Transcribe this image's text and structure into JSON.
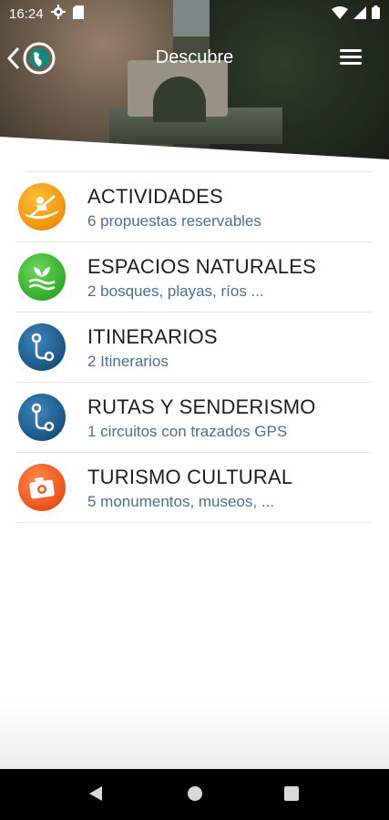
{
  "status_bar": {
    "time": "16:24"
  },
  "app_bar": {
    "title": "Descubre"
  },
  "colors": {
    "orange": "#f29a12",
    "green": "#39b233",
    "blue": "#1f5c8c",
    "red": "#f05a22",
    "subtitle": "#4a6f93"
  },
  "items": [
    {
      "title": "ACTIVIDADES",
      "subtitle": "6 propuestas reservables",
      "icon": "kayak-icon"
    },
    {
      "title": "ESPACIOS NATURALES",
      "subtitle": "2 bosques, playas, ríos ...",
      "icon": "nature-icon"
    },
    {
      "title": "ITINERARIOS",
      "subtitle": "2 Itinerarios",
      "icon": "route-icon"
    },
    {
      "title": "RUTAS Y SENDERISMO",
      "subtitle": "1 circuitos con trazados GPS",
      "icon": "route-icon"
    },
    {
      "title": "TURISMO CULTURAL",
      "subtitle": "5 monumentos, museos, ...",
      "icon": "camera-icon"
    }
  ]
}
